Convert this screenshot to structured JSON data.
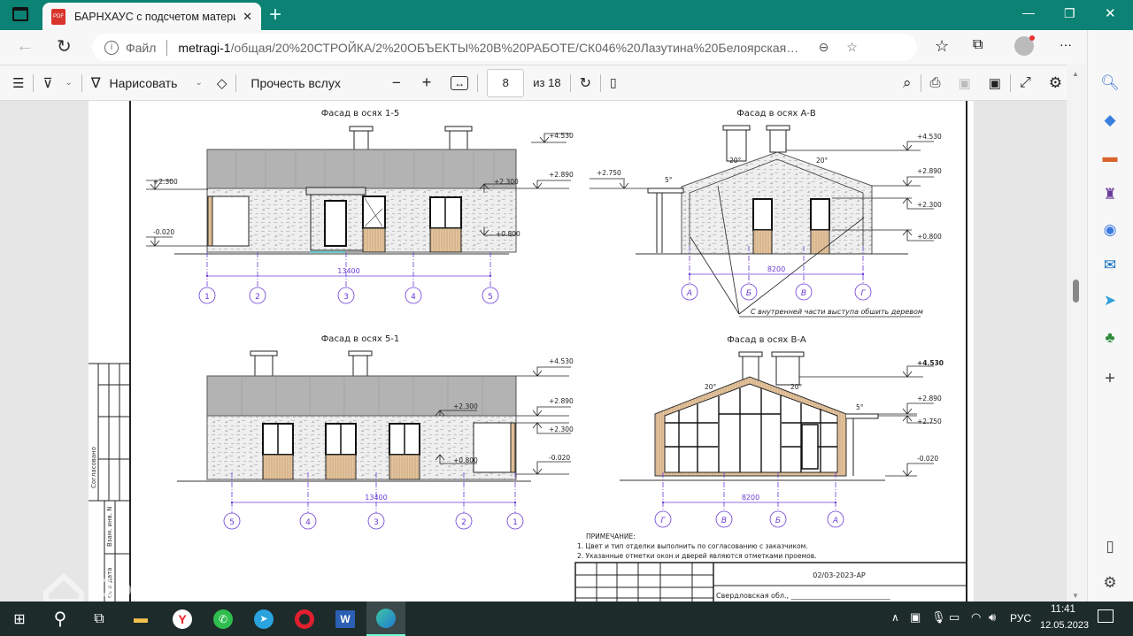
{
  "browser": {
    "tab_title": "БАРНХАУС с подсчетом матери",
    "new_tab": "+",
    "window_controls": {
      "minimize": "—",
      "restore": "❐",
      "close": "✕"
    },
    "address": {
      "info_label": "Файл",
      "host": "metragi-1",
      "path": "/общая/20%20СТРОЙКА/2%20ОБЪЕКТЫ%20В%20РАБОТЕ/СК046%20Лазутина%20Белоярская%20заст..."
    },
    "more": "···"
  },
  "pdf_toolbar": {
    "draw_label": "Нарисовать",
    "read_aloud_label": "Прочесть вслух",
    "page_current": "8",
    "page_total_label": "из 18",
    "zoom_out": "−",
    "zoom_in": "+"
  },
  "drawing": {
    "facade_1_5": {
      "title": "Фасад в осях 1-5",
      "axes": [
        "1",
        "2",
        "3",
        "4",
        "5"
      ],
      "dimension": "13400",
      "levels": {
        "top": "+4.530",
        "eave": "+2.890",
        "left_top": "+2.300",
        "left_bottom": "-0.020",
        "win_top": "+2.300",
        "win_bottom": "+0.800"
      }
    },
    "facade_a_v": {
      "title": "Фасад в осях А-В",
      "axes": [
        "А",
        "Б",
        "В",
        "Г"
      ],
      "dimension": "8200",
      "levels": {
        "top": "+4.530",
        "eave": "+2.890",
        "win_top": "+2.300",
        "win_bottom": "+0.800",
        "canopy": "+2.750"
      },
      "slopes": {
        "left": "20°",
        "right": "20°",
        "canopy": "5°"
      },
      "note": "С внутренней части выступа обшить деревом"
    },
    "facade_5_1": {
      "title": "Фасад в осях 5-1",
      "axes": [
        "5",
        "4",
        "3",
        "2",
        "1"
      ],
      "dimension": "13400",
      "levels": {
        "top": "+4.530",
        "eave": "+2.890",
        "inner": "+2.300",
        "win_top": "+2.300",
        "win_bottom": "+0.800",
        "ground": "-0.020"
      }
    },
    "facade_v_a": {
      "title": "Фасад в осях В-А",
      "axes": [
        "Г",
        "В",
        "Б",
        "А"
      ],
      "dimension": "8200",
      "levels": {
        "top": "+4.530",
        "eave": "+2.890",
        "canopy": "+2.750",
        "ground": "-0.020"
      },
      "slopes": {
        "left": "20°",
        "right": "20°",
        "canopy": "5°"
      }
    },
    "notes": {
      "heading": "ПРИМЕЧАНИЕ:",
      "items": [
        "1. Цвет и тип отделки выполнить по согласованию с заказчиком.",
        "2. Указанные отметки окон и дверей являются отметками проемов."
      ]
    },
    "title_block": {
      "code": "02/03-2023-АР",
      "location": "Свердловская обл., ____________________________"
    },
    "stamp": {
      "agreed": "Согласовано",
      "replace": "Взам. инв. N",
      "signature": "сь и дата"
    },
    "watermark": "Домклик"
  },
  "taskbar": {
    "lang": "РУС",
    "time": "11:41",
    "date": "12.05.2023"
  },
  "colors": {
    "teal": "#0b8273",
    "axis": "#6a3bd6",
    "roof": "#b3b3b3",
    "wood": "#e6c6a0"
  }
}
